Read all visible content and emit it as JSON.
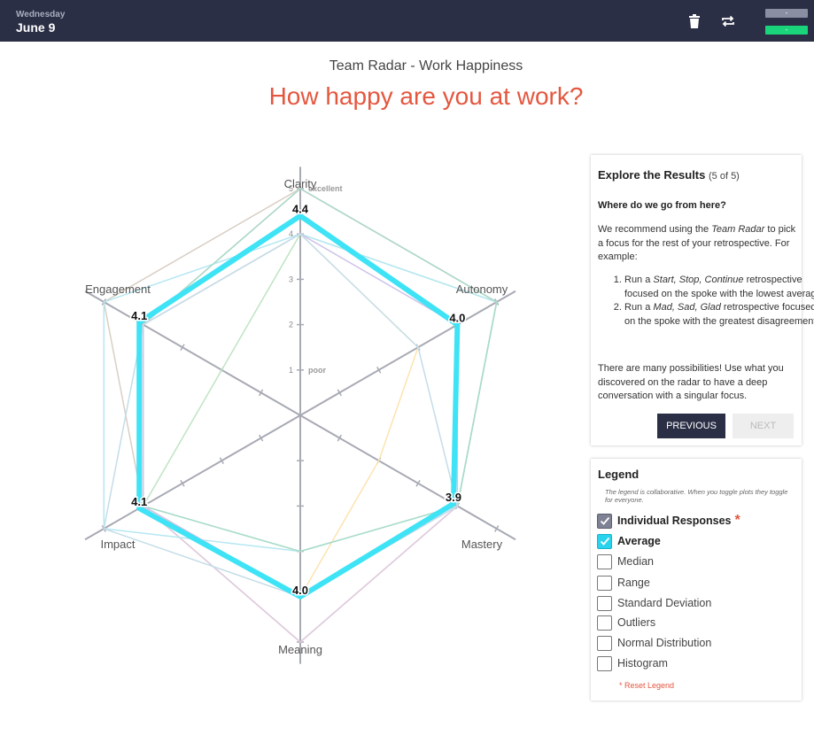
{
  "header": {
    "weekday": "Wednesday",
    "date": "June 9",
    "delete_icon": "trash-icon",
    "swap_icon": "repeat-icon",
    "pill_top": "-",
    "pill_bottom": "-"
  },
  "page": {
    "subtitle": "Team Radar - Work Happiness",
    "question": "How happy are you at work?"
  },
  "colors": {
    "accent": "#e4573f",
    "navy": "#2b2f45",
    "average": "#3ee3f5",
    "status_green": "#19d47a"
  },
  "chart_data": {
    "type": "radar",
    "axes": [
      "Clarity",
      "Autonomy",
      "Mastery",
      "Meaning",
      "Impact",
      "Engagement"
    ],
    "range": [
      0,
      5
    ],
    "scale_words": {
      "1": "poor",
      "5": "excellent"
    },
    "series": [
      {
        "name": "Average",
        "values": [
          4.4,
          4.0,
          3.9,
          4.0,
          4.1,
          4.1
        ],
        "color": "#3ee3f5"
      },
      {
        "values": [
          5,
          5,
          4,
          5,
          4,
          4
        ],
        "color": "#f2b9ad"
      },
      {
        "values": [
          5,
          5,
          4,
          4,
          4,
          5
        ],
        "color": "#d9cfc4"
      },
      {
        "values": [
          5,
          5,
          4,
          5,
          4,
          4
        ],
        "color": "#dccbe0"
      },
      {
        "values": [
          4,
          5,
          4,
          3,
          4,
          2
        ],
        "color": "#bfe4c4"
      },
      {
        "values": [
          4,
          5,
          4,
          3,
          5,
          5
        ],
        "color": "#b5e7f2"
      },
      {
        "values": [
          4,
          3,
          2,
          4,
          4,
          4
        ],
        "color": "#fde3b0"
      },
      {
        "values": [
          5,
          5,
          4,
          3,
          4,
          4
        ],
        "color": "#a9dcc9"
      },
      {
        "values": [
          4,
          4,
          4,
          4,
          4,
          4
        ],
        "color": "#cfc3e8"
      },
      {
        "values": [
          4,
          3,
          4,
          4,
          5,
          4
        ],
        "color": "#c4dde8"
      }
    ]
  },
  "explore": {
    "title": "Explore the Results",
    "count": "(5 of 5)",
    "question": "Where do we go from here?",
    "intro_a": "We recommend using the ",
    "intro_em": "Team Radar",
    "intro_b": " to pick a focus for the rest of your retrospective. For example:",
    "item1_a": "Run a ",
    "item1_em": "Start, Stop, Continue",
    "item1_b": " retrospective focused on the spoke with the lowest average",
    "item2_a": "Run a ",
    "item2_em": "Mad, Sad, Glad",
    "item2_b": " retrospective focused on the spoke with the greatest disagreement",
    "outro": "There are many possibilities! Use what you discovered on the radar to have a deep conversation with a singular focus.",
    "prev_label": "PREVIOUS",
    "next_label": "NEXT"
  },
  "legend": {
    "title": "Legend",
    "note": "The legend is collaborative. When you toggle plots they toggle for everyone.",
    "items": [
      {
        "label": "Individual Responses",
        "checked": true,
        "style": "grey",
        "bold": true,
        "star": "*"
      },
      {
        "label": "Average",
        "checked": true,
        "style": "cyan",
        "bold": true
      },
      {
        "label": "Median",
        "checked": false
      },
      {
        "label": "Range",
        "checked": false
      },
      {
        "label": "Standard Deviation",
        "checked": false
      },
      {
        "label": "Outliers",
        "checked": false
      },
      {
        "label": "Normal Distribution",
        "checked": false
      },
      {
        "label": "Histogram",
        "checked": false
      }
    ],
    "reset_label": "* Reset Legend"
  }
}
